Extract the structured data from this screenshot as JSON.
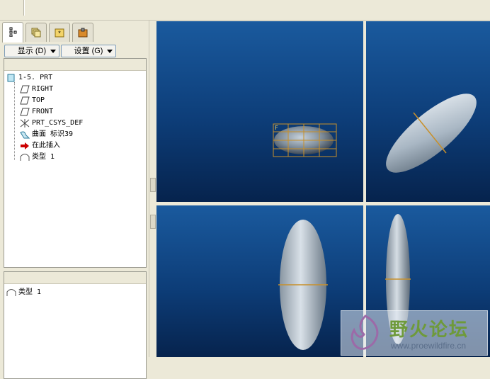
{
  "tabs": [
    {
      "icon": "model-tree-icon",
      "active": true
    },
    {
      "icon": "layers-icon",
      "active": false
    },
    {
      "icon": "favorites-icon",
      "active": false
    },
    {
      "icon": "tools-icon",
      "active": false
    }
  ],
  "toolbar": {
    "show_label": "显示 (D)",
    "settings_label": "设置 (G)"
  },
  "tree": {
    "root": "1-5. PRT",
    "items": [
      {
        "label": "RIGHT",
        "icon": "datum-plane-icon"
      },
      {
        "label": "TOP",
        "icon": "datum-plane-icon"
      },
      {
        "label": "FRONT",
        "icon": "datum-plane-icon"
      },
      {
        "label": "PRT_CSYS_DEF",
        "icon": "csys-icon"
      },
      {
        "label": "曲面 标识39",
        "icon": "surface-icon"
      },
      {
        "label": "在此插入",
        "icon": "insert-here-arrow-icon"
      },
      {
        "label": "类型  1",
        "icon": "feature-type-icon"
      }
    ]
  },
  "detail": {
    "items": [
      {
        "label": "类型  1",
        "icon": "feature-type-icon"
      }
    ]
  },
  "watermark": {
    "title": "野火论坛",
    "url": "www.proewildfire.cn"
  },
  "colors": {
    "viewport_top": "#1a5a9e",
    "viewport_bottom": "#06234d",
    "insert_arrow": "#cc0000",
    "curve": "#c8902a"
  }
}
